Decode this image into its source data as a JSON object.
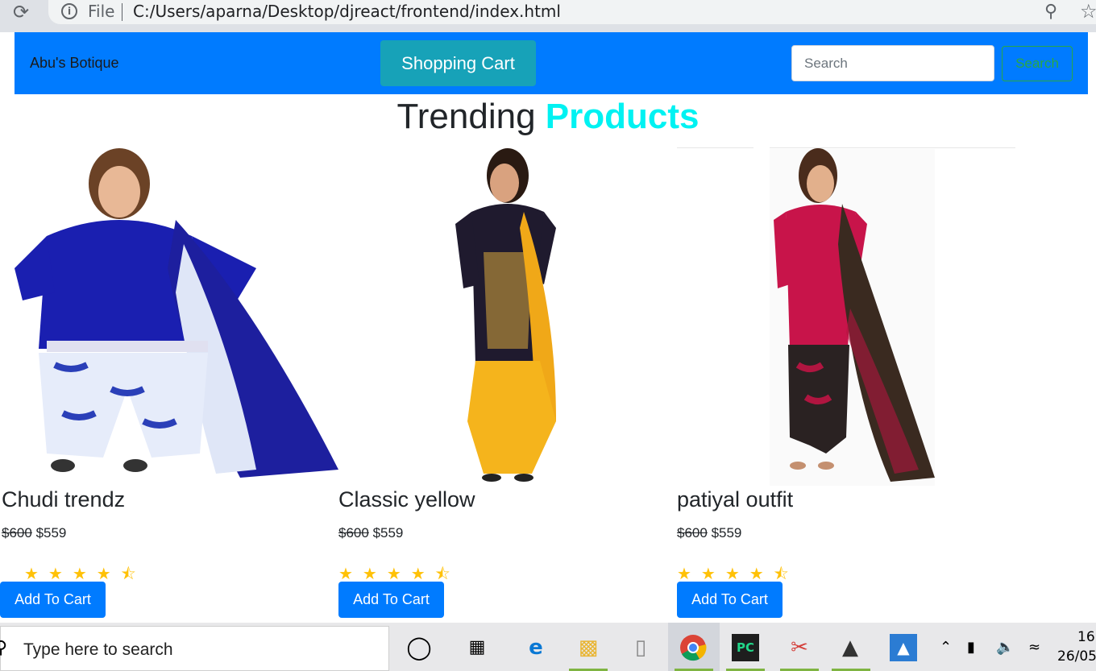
{
  "browser": {
    "reload_icon": "⟳",
    "file_label": "File",
    "url": "C:/Users/aparna/Desktop/djreact/frontend/index.html"
  },
  "navbar": {
    "brand": "Abu's Botique",
    "cart_button": "Shopping Cart",
    "search_placeholder": "Search",
    "search_button": "Search",
    "color_primary": "#007bff",
    "color_info": "#17a2b8"
  },
  "heading": {
    "part1": "Trending",
    "part2": "Products",
    "accent_color": "#00f2f2"
  },
  "products": [
    {
      "title": "Chudi trendz",
      "old_price": "$600",
      "new_price": "$559",
      "rating": 4.5,
      "button": "Add To Cart"
    },
    {
      "title": "Classic yellow",
      "old_price": "$600",
      "new_price": "$559",
      "rating": 4.5,
      "button": "Add To Cart"
    },
    {
      "title": "patiyal outfit",
      "old_price": "$600",
      "new_price": "$559",
      "rating": 4.5,
      "button": "Add To Cart"
    }
  ],
  "taskbar": {
    "search_text": "Type here to search",
    "time": "16:",
    "date": "26/05"
  }
}
